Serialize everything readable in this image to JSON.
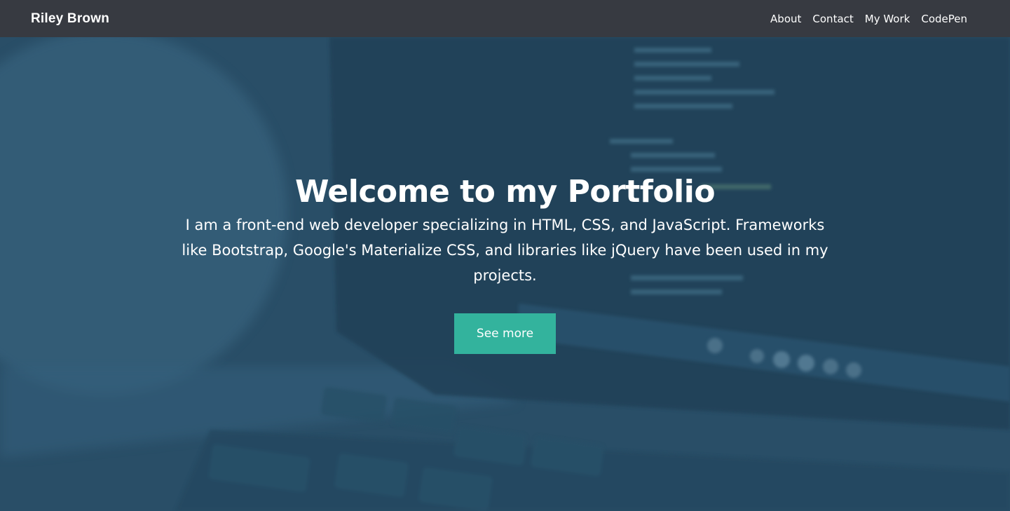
{
  "navbar": {
    "brand": "Riley Brown",
    "links": [
      "About",
      "Contact",
      "My Work",
      "CodePen"
    ]
  },
  "hero": {
    "title": "Welcome to my Portfolio",
    "text": "I am a front-end web developer specializing in HTML, CSS, and JavaScript. Frameworks like Bootstrap, Google's Materialize CSS, and libraries like jQuery have been used in my projects.",
    "button_label": "See more"
  },
  "colors": {
    "navbar": "#373a41",
    "hero_tint": "#2b4a60",
    "button": "#33b39d"
  }
}
